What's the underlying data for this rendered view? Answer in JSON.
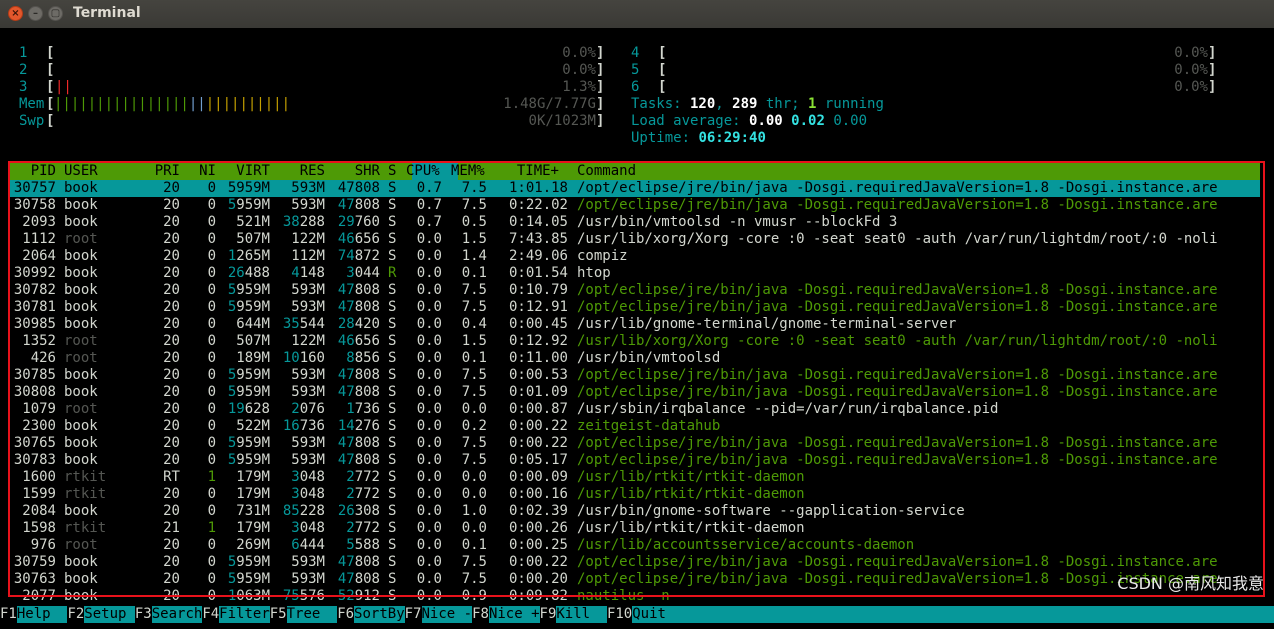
{
  "window": {
    "title": "Terminal",
    "close": "×",
    "minimize": "–",
    "maximize": "▢"
  },
  "meters": {
    "cpus": [
      {
        "num": "1",
        "open": "[",
        "bars": "",
        "pct": "0.0%",
        "close": "]"
      },
      {
        "num": "2",
        "open": "[",
        "bars": "",
        "pct": "0.0%",
        "close": "]"
      },
      {
        "num": "3",
        "open": "[",
        "bars": "||",
        "pct": "1.3%",
        "close": "]"
      },
      {
        "num": "4",
        "open": "[",
        "bars": "",
        "pct": "0.0%",
        "close": "]"
      },
      {
        "num": "5",
        "open": "[",
        "bars": "",
        "pct": "0.0%",
        "close": "]"
      },
      {
        "num": "6",
        "open": "[",
        "bars": "",
        "pct": "0.0%",
        "close": "]"
      }
    ],
    "mem": {
      "label": "Mem",
      "open": "[",
      "bars_green": "||||||||||||||||",
      "bars_blue": "||",
      "bars_yellow": "||||||||||",
      "value": "1.48G/7.77G",
      "close": "]"
    },
    "swp": {
      "label": "Swp",
      "open": "[",
      "value": "0K/1023M",
      "close": "]"
    },
    "tasks": {
      "label": "Tasks: ",
      "count": "120",
      "sep": ", ",
      "threads": "289",
      "thr_label": " thr; ",
      "running": "1",
      "running_label": " running"
    },
    "load": {
      "label": "Load average: ",
      "one": "0.00",
      "five": "0.02",
      "fifteen": "0.00"
    },
    "uptime": {
      "label": "Uptime: ",
      "value": "06:29:40"
    }
  },
  "columns": [
    "PID",
    "USER",
    "PRI",
    "NI",
    "VIRT",
    "RES",
    "SHR",
    "S",
    "CPU%",
    "MEM%",
    "TIME+",
    "Command"
  ],
  "processes": [
    {
      "pid": "30757",
      "user": "book",
      "pri": "20",
      "ni": "0",
      "virt": "5959M",
      "res": "593M",
      "shr": "47808",
      "s": "S",
      "cpu": "0.7",
      "mem": "7.5",
      "time": "1:01.18",
      "cmd": "/opt/eclipse/jre/bin/java -Dosgi.requiredJavaVersion=1.8 -Dosgi.instance.are"
    },
    {
      "pid": "30758",
      "user": "book",
      "pri": "20",
      "ni": "0",
      "virt": "5959M",
      "res": "593M",
      "shr": "47808",
      "s": "S",
      "cpu": "0.7",
      "mem": "7.5",
      "time": "0:22.02",
      "cmd": "/opt/eclipse/jre/bin/java -Dosgi.requiredJavaVersion=1.8 -Dosgi.instance.are"
    },
    {
      "pid": "2093",
      "user": "book",
      "pri": "20",
      "ni": "0",
      "virt": "521M",
      "res": "38288",
      "shr": "29760",
      "s": "S",
      "cpu": "0.7",
      "mem": "0.5",
      "time": "0:14.05",
      "cmd": "/usr/bin/vmtoolsd -n vmusr --blockFd 3"
    },
    {
      "pid": "1112",
      "user": "root",
      "pri": "20",
      "ni": "0",
      "virt": "507M",
      "res": "122M",
      "shr": "46656",
      "s": "S",
      "cpu": "0.0",
      "mem": "1.5",
      "time": "7:43.85",
      "cmd": "/usr/lib/xorg/Xorg -core :0 -seat seat0 -auth /var/run/lightdm/root/:0 -noli"
    },
    {
      "pid": "2064",
      "user": "book",
      "pri": "20",
      "ni": "0",
      "virt": "1265M",
      "res": "112M",
      "shr": "74872",
      "s": "S",
      "cpu": "0.0",
      "mem": "1.4",
      "time": "2:49.06",
      "cmd": "compiz"
    },
    {
      "pid": "30992",
      "user": "book",
      "pri": "20",
      "ni": "0",
      "virt": "26488",
      "res": "4148",
      "shr": "3044",
      "s": "R",
      "cpu": "0.0",
      "mem": "0.1",
      "time": "0:01.54",
      "cmd": "htop"
    },
    {
      "pid": "30782",
      "user": "book",
      "pri": "20",
      "ni": "0",
      "virt": "5959M",
      "res": "593M",
      "shr": "47808",
      "s": "S",
      "cpu": "0.0",
      "mem": "7.5",
      "time": "0:10.79",
      "cmd": "/opt/eclipse/jre/bin/java -Dosgi.requiredJavaVersion=1.8 -Dosgi.instance.are"
    },
    {
      "pid": "30781",
      "user": "book",
      "pri": "20",
      "ni": "0",
      "virt": "5959M",
      "res": "593M",
      "shr": "47808",
      "s": "S",
      "cpu": "0.0",
      "mem": "7.5",
      "time": "0:12.91",
      "cmd": "/opt/eclipse/jre/bin/java -Dosgi.requiredJavaVersion=1.8 -Dosgi.instance.are"
    },
    {
      "pid": "30985",
      "user": "book",
      "pri": "20",
      "ni": "0",
      "virt": "644M",
      "res": "35544",
      "shr": "28420",
      "s": "S",
      "cpu": "0.0",
      "mem": "0.4",
      "time": "0:00.45",
      "cmd": "/usr/lib/gnome-terminal/gnome-terminal-server"
    },
    {
      "pid": "1352",
      "user": "root",
      "pri": "20",
      "ni": "0",
      "virt": "507M",
      "res": "122M",
      "shr": "46656",
      "s": "S",
      "cpu": "0.0",
      "mem": "1.5",
      "time": "0:12.92",
      "cmd": "/usr/lib/xorg/Xorg -core :0 -seat seat0 -auth /var/run/lightdm/root/:0 -noli"
    },
    {
      "pid": "426",
      "user": "root",
      "pri": "20",
      "ni": "0",
      "virt": "189M",
      "res": "10160",
      "shr": "8856",
      "s": "S",
      "cpu": "0.0",
      "mem": "0.1",
      "time": "0:11.00",
      "cmd": "/usr/bin/vmtoolsd"
    },
    {
      "pid": "30785",
      "user": "book",
      "pri": "20",
      "ni": "0",
      "virt": "5959M",
      "res": "593M",
      "shr": "47808",
      "s": "S",
      "cpu": "0.0",
      "mem": "7.5",
      "time": "0:00.53",
      "cmd": "/opt/eclipse/jre/bin/java -Dosgi.requiredJavaVersion=1.8 -Dosgi.instance.are"
    },
    {
      "pid": "30808",
      "user": "book",
      "pri": "20",
      "ni": "0",
      "virt": "5959M",
      "res": "593M",
      "shr": "47808",
      "s": "S",
      "cpu": "0.0",
      "mem": "7.5",
      "time": "0:01.09",
      "cmd": "/opt/eclipse/jre/bin/java -Dosgi.requiredJavaVersion=1.8 -Dosgi.instance.are"
    },
    {
      "pid": "1079",
      "user": "root",
      "pri": "20",
      "ni": "0",
      "virt": "19628",
      "res": "2076",
      "shr": "1736",
      "s": "S",
      "cpu": "0.0",
      "mem": "0.0",
      "time": "0:00.87",
      "cmd": "/usr/sbin/irqbalance --pid=/var/run/irqbalance.pid"
    },
    {
      "pid": "2300",
      "user": "book",
      "pri": "20",
      "ni": "0",
      "virt": "522M",
      "res": "16736",
      "shr": "14276",
      "s": "S",
      "cpu": "0.0",
      "mem": "0.2",
      "time": "0:00.22",
      "cmd": "zeitgeist-datahub"
    },
    {
      "pid": "30765",
      "user": "book",
      "pri": "20",
      "ni": "0",
      "virt": "5959M",
      "res": "593M",
      "shr": "47808",
      "s": "S",
      "cpu": "0.0",
      "mem": "7.5",
      "time": "0:00.22",
      "cmd": "/opt/eclipse/jre/bin/java -Dosgi.requiredJavaVersion=1.8 -Dosgi.instance.are"
    },
    {
      "pid": "30783",
      "user": "book",
      "pri": "20",
      "ni": "0",
      "virt": "5959M",
      "res": "593M",
      "shr": "47808",
      "s": "S",
      "cpu": "0.0",
      "mem": "7.5",
      "time": "0:05.17",
      "cmd": "/opt/eclipse/jre/bin/java -Dosgi.requiredJavaVersion=1.8 -Dosgi.instance.are"
    },
    {
      "pid": "1600",
      "user": "rtkit",
      "pri": "RT",
      "ni": "1",
      "virt": "179M",
      "res": "3048",
      "shr": "2772",
      "s": "S",
      "cpu": "0.0",
      "mem": "0.0",
      "time": "0:00.09",
      "cmd": "/usr/lib/rtkit/rtkit-daemon"
    },
    {
      "pid": "1599",
      "user": "rtkit",
      "pri": "20",
      "ni": "0",
      "virt": "179M",
      "res": "3048",
      "shr": "2772",
      "s": "S",
      "cpu": "0.0",
      "mem": "0.0",
      "time": "0:00.16",
      "cmd": "/usr/lib/rtkit/rtkit-daemon"
    },
    {
      "pid": "2084",
      "user": "book",
      "pri": "20",
      "ni": "0",
      "virt": "731M",
      "res": "85228",
      "shr": "26308",
      "s": "S",
      "cpu": "0.0",
      "mem": "1.0",
      "time": "0:02.39",
      "cmd": "/usr/bin/gnome-software --gapplication-service"
    },
    {
      "pid": "1598",
      "user": "rtkit",
      "pri": "21",
      "ni": "1",
      "virt": "179M",
      "res": "3048",
      "shr": "2772",
      "s": "S",
      "cpu": "0.0",
      "mem": "0.0",
      "time": "0:00.26",
      "cmd": "/usr/lib/rtkit/rtkit-daemon"
    },
    {
      "pid": "976",
      "user": "root",
      "pri": "20",
      "ni": "0",
      "virt": "269M",
      "res": "6444",
      "shr": "5588",
      "s": "S",
      "cpu": "0.0",
      "mem": "0.1",
      "time": "0:00.25",
      "cmd": "/usr/lib/accountsservice/accounts-daemon"
    },
    {
      "pid": "30759",
      "user": "book",
      "pri": "20",
      "ni": "0",
      "virt": "5959M",
      "res": "593M",
      "shr": "47808",
      "s": "S",
      "cpu": "0.0",
      "mem": "7.5",
      "time": "0:00.22",
      "cmd": "/opt/eclipse/jre/bin/java -Dosgi.requiredJavaVersion=1.8 -Dosgi.instance.are"
    },
    {
      "pid": "30763",
      "user": "book",
      "pri": "20",
      "ni": "0",
      "virt": "5959M",
      "res": "593M",
      "shr": "47808",
      "s": "S",
      "cpu": "0.0",
      "mem": "7.5",
      "time": "0:00.20",
      "cmd": "/opt/eclipse/jre/bin/java -Dosgi.requiredJavaVersion=1.8 -Dosgi.instance.are"
    },
    {
      "pid": "2077",
      "user": "book",
      "pri": "20",
      "ni": "0",
      "virt": "1063M",
      "res": "75576",
      "shr": "52912",
      "s": "S",
      "cpu": "0.0",
      "mem": "0.9",
      "time": "0:09.82",
      "cmd": "nautilus -n"
    }
  ],
  "fkeys": [
    {
      "key": "F1",
      "label": "Help  "
    },
    {
      "key": "F2",
      "label": "Setup "
    },
    {
      "key": "F3",
      "label": "Search"
    },
    {
      "key": "F4",
      "label": "Filter"
    },
    {
      "key": "F5",
      "label": "Tree  "
    },
    {
      "key": "F6",
      "label": "SortBy"
    },
    {
      "key": "F7",
      "label": "Nice -"
    },
    {
      "key": "F8",
      "label": "Nice +"
    },
    {
      "key": "F9",
      "label": "Kill  "
    },
    {
      "key": "F10",
      "label": "Quit"
    }
  ],
  "watermark": "CSDN @南风知我意",
  "colors": {
    "header_bg": "#4e9a06",
    "selected_bg": "#06989a",
    "highlight_border": "#e8121b",
    "thread_cmd": "#4e9a06"
  }
}
